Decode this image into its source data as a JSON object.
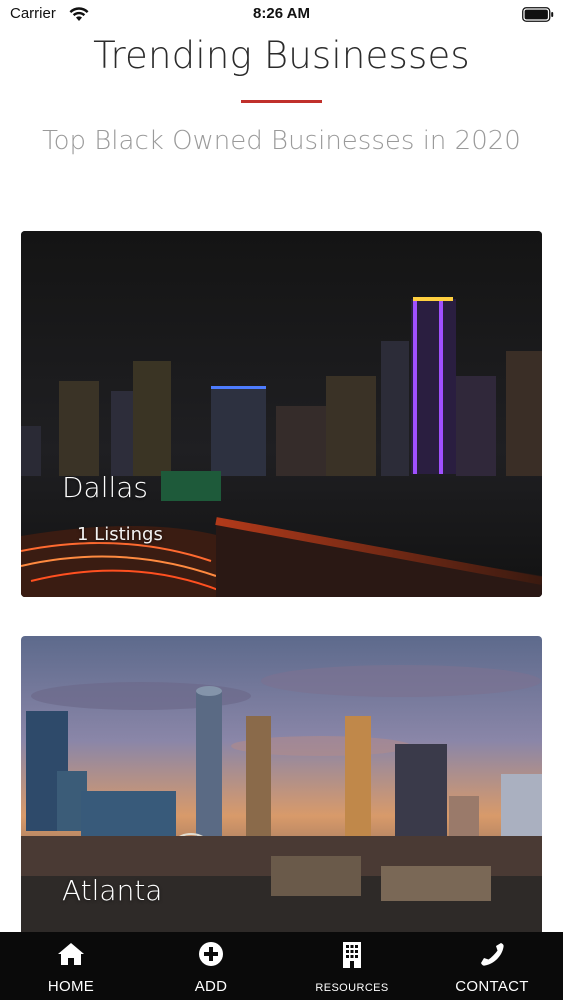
{
  "status_bar": {
    "carrier": "Carrier",
    "time": "8:26 AM",
    "icons": [
      "wifi-icon",
      "battery-icon"
    ]
  },
  "header": {
    "title": "Trending Businesses",
    "subtitle": "Top Black Owned Businesses in 2020",
    "accent_color": "#c0302b"
  },
  "cities": [
    {
      "name": "Dallas",
      "listings": "1 Listings"
    },
    {
      "name": "Atlanta"
    }
  ],
  "tab_bar": {
    "tabs": [
      {
        "label": "HOME",
        "icon": "home-icon"
      },
      {
        "label": "ADD",
        "icon": "plus-circle-icon"
      },
      {
        "label": "RESOURCES",
        "icon": "building-icon"
      },
      {
        "label": "CONTACT",
        "icon": "phone-icon"
      }
    ]
  }
}
